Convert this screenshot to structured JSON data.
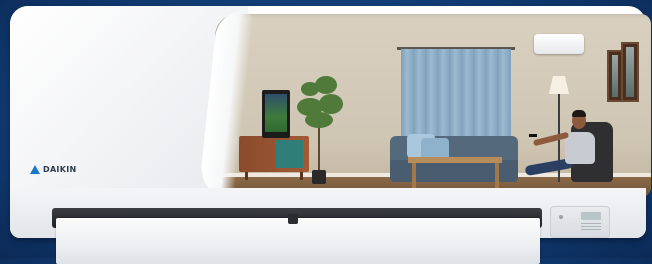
{
  "brand": {
    "logo_text": "DAIKIN",
    "accent": "#1b78c9"
  },
  "scene": {
    "description_hidden": ""
  },
  "colors": {
    "background": "#123f78",
    "unit_body": "#f3f4f6"
  }
}
